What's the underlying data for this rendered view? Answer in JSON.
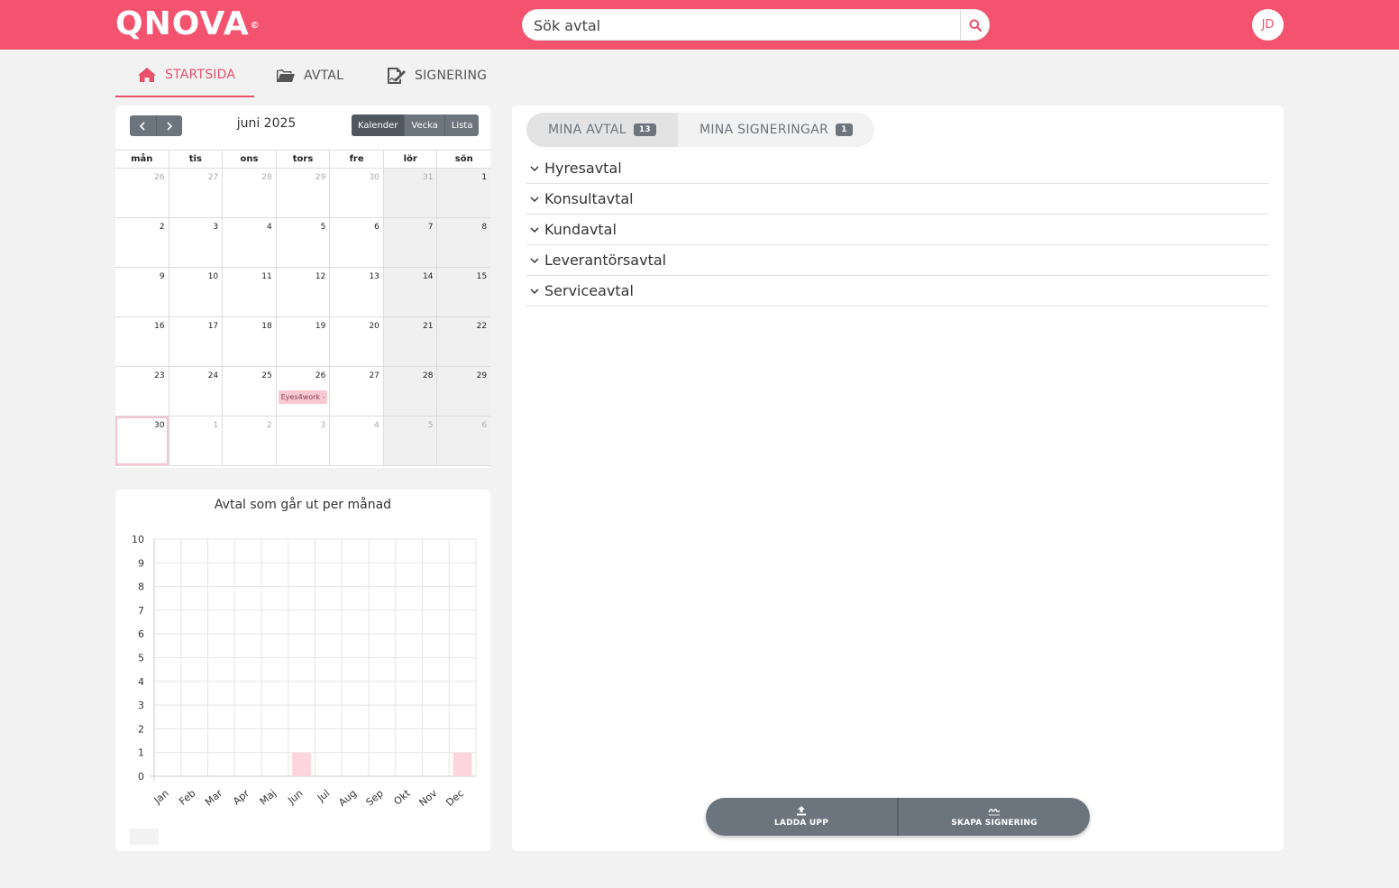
{
  "header": {
    "logo": "QNOVA",
    "logo_mark": "©",
    "search_placeholder": "Sök avtal",
    "user_initials": "JD",
    "brand_color": "#f4536f"
  },
  "nav": {
    "tabs": [
      {
        "label": "STARTSIDA",
        "icon": "home-icon",
        "active": true
      },
      {
        "label": "AVTAL",
        "icon": "folder-open-icon",
        "active": false
      },
      {
        "label": "SIGNERING",
        "icon": "signature-icon",
        "active": false
      }
    ]
  },
  "calendar": {
    "title": "juni 2025",
    "views": [
      "Kalender",
      "Vecka",
      "Lista"
    ],
    "weekdays": [
      "mån",
      "tis",
      "ons",
      "tors",
      "fre",
      "lör",
      "sön"
    ],
    "weeks": [
      [
        "26",
        "27",
        "28",
        "29",
        "30",
        "31",
        "1"
      ],
      [
        "2",
        "3",
        "4",
        "5",
        "6",
        "7",
        "8"
      ],
      [
        "9",
        "10",
        "11",
        "12",
        "13",
        "14",
        "15"
      ],
      [
        "16",
        "17",
        "18",
        "19",
        "20",
        "21",
        "22"
      ],
      [
        "23",
        "24",
        "25",
        "26",
        "27",
        "28",
        "29"
      ],
      [
        "30",
        "1",
        "2",
        "3",
        "4",
        "5",
        "6"
      ]
    ],
    "event": {
      "label": "Eyes4work -",
      "week": 4,
      "day": 3
    }
  },
  "chart_data": {
    "type": "bar",
    "title": "Avtal som går ut per månad",
    "categories": [
      "Jan",
      "Feb",
      "Mar",
      "Apr",
      "Maj",
      "Jun",
      "Jul",
      "Aug",
      "Sep",
      "Okt",
      "Nov",
      "Dec"
    ],
    "values": [
      0,
      0,
      0,
      0,
      0,
      1,
      0,
      0,
      0,
      0,
      0,
      1
    ],
    "ylim": [
      0,
      10
    ],
    "yticks": [
      0,
      1,
      2,
      3,
      4,
      5,
      6,
      7,
      8,
      9,
      10
    ],
    "grid": true,
    "bar_color": "#fdd5dc"
  },
  "main": {
    "tabs": [
      {
        "label": "MINA AVTAL",
        "count": "13",
        "active": true
      },
      {
        "label": "MINA SIGNERINGAR",
        "count": "1",
        "active": false
      }
    ],
    "categories": [
      "Hyresavtal",
      "Konsultavtal",
      "Kundavtal",
      "Leverantörsavtal",
      "Serviceavtal"
    ],
    "actions": [
      {
        "label": "LADDA UPP",
        "icon": "upload-icon"
      },
      {
        "label": "SKAPA SIGNERING",
        "icon": "signature-icon"
      }
    ]
  }
}
